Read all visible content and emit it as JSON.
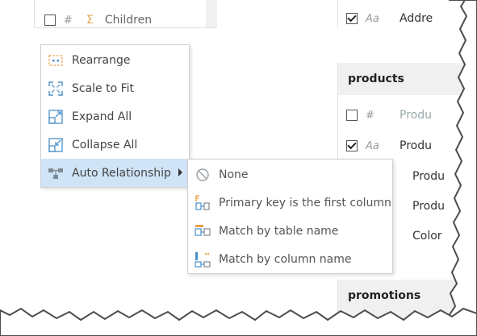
{
  "top_left_table": {
    "row": {
      "type": "#",
      "name": "Children"
    }
  },
  "top_right_table": {
    "row": {
      "type": "Aa",
      "name": "Addre"
    }
  },
  "products_table": {
    "title": "products",
    "rows": [
      {
        "type": "#",
        "name": "Produ"
      },
      {
        "type": "Aa",
        "name": "Produ"
      },
      {
        "type": "",
        "name": "Produ"
      },
      {
        "type": "",
        "name": "Produ"
      },
      {
        "type": "",
        "name": "Color"
      }
    ]
  },
  "promotions_table": {
    "title": "promotions"
  },
  "context_menu": {
    "items": [
      {
        "label": "Rearrange",
        "icon": "rearrange-icon"
      },
      {
        "label": "Scale to Fit",
        "icon": "scale-to-fit-icon"
      },
      {
        "label": "Expand All",
        "icon": "expand-all-icon"
      },
      {
        "label": "Collapse All",
        "icon": "collapse-all-icon"
      },
      {
        "label": "Auto Relationship",
        "icon": "auto-relationship-icon"
      }
    ]
  },
  "submenu": {
    "items": [
      {
        "label": "None",
        "icon": "none-icon"
      },
      {
        "label": "Primary key is the first column",
        "icon": "primary-key-icon"
      },
      {
        "label": "Match by table name",
        "icon": "match-table-icon"
      },
      {
        "label": "Match by column name",
        "icon": "match-column-icon"
      }
    ]
  },
  "colors": {
    "accent": "#4a90c8",
    "highlight": "#cfe4f6",
    "icon_orange": "#e8a34a"
  }
}
